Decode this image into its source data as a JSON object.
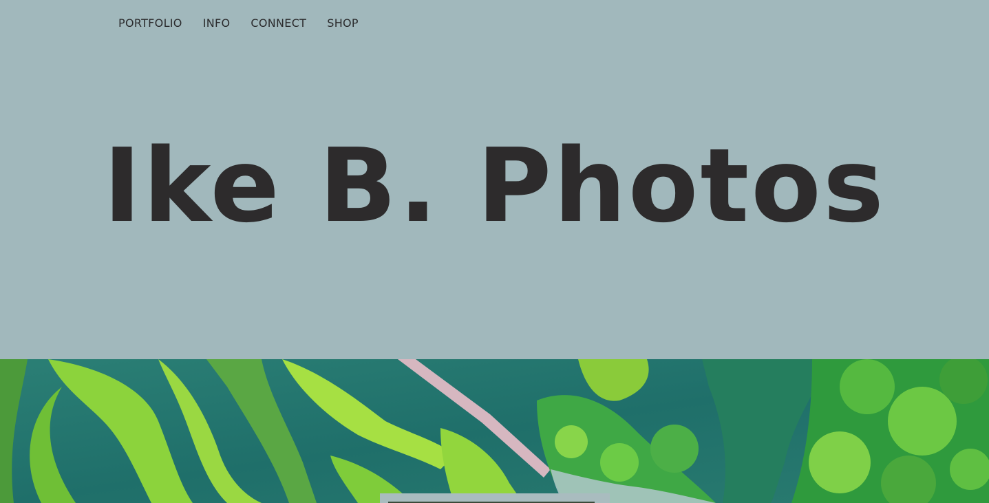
{
  "nav": {
    "items": [
      {
        "label": "PORTFOLIO"
      },
      {
        "label": "INFO"
      },
      {
        "label": "CONNECT"
      },
      {
        "label": "SHOP"
      }
    ]
  },
  "hero": {
    "title": "Ike B. Photos"
  },
  "colors": {
    "background": "#a1b8bc",
    "text": "#2d2b2c",
    "water": "#2f8074",
    "vegetation": "#7ccf3a",
    "boardwalk": "#d6b7c0"
  }
}
